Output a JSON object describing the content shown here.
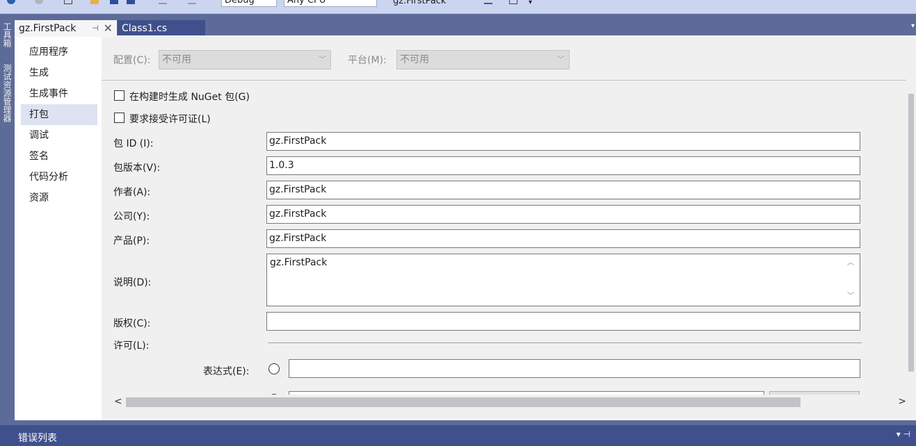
{
  "toolbar": {
    "config_combo": "Debug",
    "platform_combo": "Any CPU",
    "startup": "gz.FirstPack"
  },
  "side_tabs": [
    "工具箱",
    "测试资源管理器"
  ],
  "tabs": [
    {
      "label": "gz.FirstPack",
      "pin": "⊣",
      "close": "✕"
    },
    {
      "label": "Class1.cs"
    }
  ],
  "nav": {
    "items": [
      "应用程序",
      "生成",
      "生成事件",
      "打包",
      "调试",
      "签名",
      "代码分析",
      "资源"
    ],
    "selected": "打包"
  },
  "config_bar": {
    "config_label": "配置(C):",
    "config_value": "不可用",
    "platform_label": "平台(M):",
    "platform_value": "不可用"
  },
  "checkboxes": {
    "nuget_on_build": "在构建时生成 NuGet 包(G)",
    "require_license": "要求接受许可证(L)"
  },
  "fields": {
    "package_id": {
      "label": "包 ID (I):",
      "value": "gz.FirstPack"
    },
    "version": {
      "label": "包版本(V):",
      "value": "1.0.3"
    },
    "authors": {
      "label": "作者(A):",
      "value": "gz.FirstPack"
    },
    "company": {
      "label": "公司(Y):",
      "value": "gz.FirstPack"
    },
    "product": {
      "label": "产品(P):",
      "value": "gz.FirstPack"
    },
    "description": {
      "label": "说明(D):",
      "value": "gz.FirstPack"
    },
    "copyright": {
      "label": "版权(C):",
      "value": ""
    },
    "license": {
      "label": "许可(L):"
    },
    "expression": {
      "label": "表达式(E):",
      "value": ""
    }
  },
  "bottom": {
    "title": "错误列表",
    "ctrls": "▾  ⊣"
  },
  "icons": {
    "dropdown": "▾",
    "chevron_up": "︿",
    "chevron_down": "﹀",
    "scroll_left": "<",
    "scroll_right": ">"
  }
}
